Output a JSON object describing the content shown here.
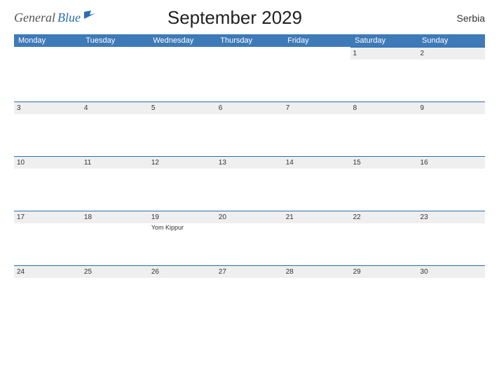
{
  "brand": {
    "part1": "General",
    "part2": "Blue"
  },
  "title": "September 2029",
  "country": "Serbia",
  "dow": [
    "Monday",
    "Tuesday",
    "Wednesday",
    "Thursday",
    "Friday",
    "Saturday",
    "Sunday"
  ],
  "weeks": [
    [
      {
        "n": ""
      },
      {
        "n": ""
      },
      {
        "n": ""
      },
      {
        "n": ""
      },
      {
        "n": ""
      },
      {
        "n": "1"
      },
      {
        "n": "2"
      }
    ],
    [
      {
        "n": "3"
      },
      {
        "n": "4"
      },
      {
        "n": "5"
      },
      {
        "n": "6"
      },
      {
        "n": "7"
      },
      {
        "n": "8"
      },
      {
        "n": "9"
      }
    ],
    [
      {
        "n": "10"
      },
      {
        "n": "11"
      },
      {
        "n": "12"
      },
      {
        "n": "13"
      },
      {
        "n": "14"
      },
      {
        "n": "15"
      },
      {
        "n": "16"
      }
    ],
    [
      {
        "n": "17"
      },
      {
        "n": "18"
      },
      {
        "n": "19",
        "event": "Yom Kippur"
      },
      {
        "n": "20"
      },
      {
        "n": "21"
      },
      {
        "n": "22"
      },
      {
        "n": "23"
      }
    ],
    [
      {
        "n": "24"
      },
      {
        "n": "25"
      },
      {
        "n": "26"
      },
      {
        "n": "27"
      },
      {
        "n": "28"
      },
      {
        "n": "29"
      },
      {
        "n": "30"
      }
    ]
  ]
}
